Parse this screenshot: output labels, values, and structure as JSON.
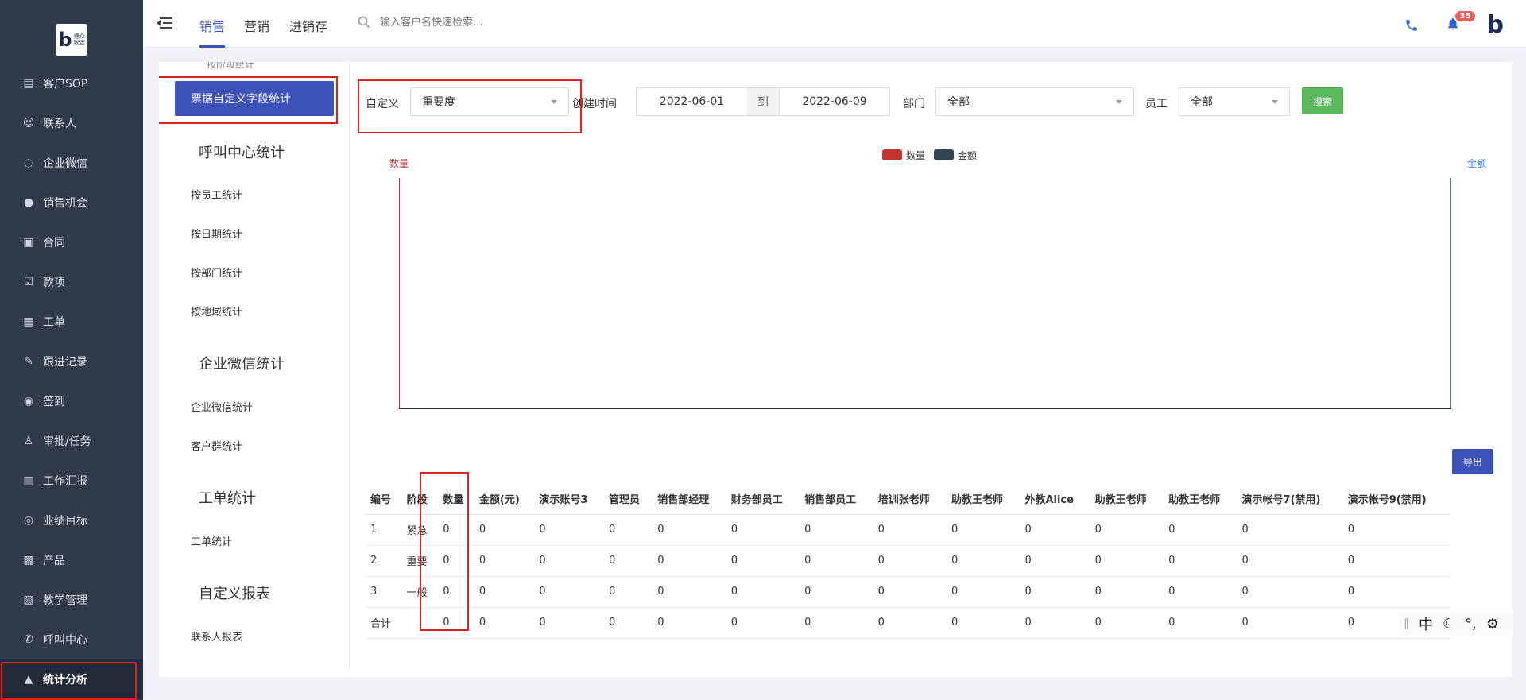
{
  "logo": {
    "letter": "b",
    "line1": "博众",
    "line2": "致远"
  },
  "nav": {
    "items": [
      {
        "label": "客户SOP",
        "icon": "sop-icon"
      },
      {
        "label": "联系人",
        "icon": "person-icon"
      },
      {
        "label": "企业微信",
        "icon": "chat-icon"
      },
      {
        "label": "销售机会",
        "icon": "moneybag-icon"
      },
      {
        "label": "合同",
        "icon": "contract-icon"
      },
      {
        "label": "款项",
        "icon": "payment-icon"
      },
      {
        "label": "工单",
        "icon": "ticket-icon"
      },
      {
        "label": "跟进记录",
        "icon": "edit-icon"
      },
      {
        "label": "签到",
        "icon": "location-icon"
      },
      {
        "label": "审批/任务",
        "icon": "approval-icon"
      },
      {
        "label": "工作汇报",
        "icon": "report-icon"
      },
      {
        "label": "业绩目标",
        "icon": "target-icon"
      },
      {
        "label": "产品",
        "icon": "grid-icon"
      },
      {
        "label": "教学管理",
        "icon": "teaching-icon"
      },
      {
        "label": "呼叫中心",
        "icon": "phone-icon"
      },
      {
        "label": "统计分析",
        "icon": "chart-icon",
        "active": true
      }
    ]
  },
  "topbar": {
    "tabs": [
      "销售",
      "营销",
      "进销存"
    ],
    "active_tab": 0,
    "search_placeholder": "输入客户名快速检索...",
    "notification_count": "35"
  },
  "subnav": {
    "cut_text": "按阶段统计",
    "active": "票据自定义字段统计",
    "groups": [
      {
        "title": "呼叫中心统计",
        "links": [
          "按员工统计",
          "按日期统计",
          "按部门统计",
          "按地域统计"
        ]
      },
      {
        "title": "企业微信统计",
        "links": [
          "企业微信统计",
          "客户群统计"
        ]
      },
      {
        "title": "工单统计",
        "links": [
          "工单统计"
        ]
      },
      {
        "title": "自定义报表",
        "links": [
          "联系人报表"
        ]
      }
    ]
  },
  "filters": {
    "custom_label": "自定义",
    "custom_value": "重要度",
    "created_label": "创建时间",
    "date_from": "2022-06-01",
    "to_label": "到",
    "date_to": "2022-06-09",
    "dept_label": "部门",
    "dept_value": "全部",
    "staff_label": "员工",
    "staff_value": "全部",
    "search_button": "搜索"
  },
  "export_button": "导出",
  "chart_data": {
    "type": "bar",
    "categories": [],
    "series": [
      {
        "name": "数量",
        "values": [],
        "color": "#c23531"
      },
      {
        "name": "金额",
        "values": [],
        "color": "#2f4554"
      }
    ],
    "ylabel_left": "数量",
    "ylabel_right": "金额",
    "legend": "top-center"
  },
  "table": {
    "headers": [
      "编号",
      "阶段",
      "数量",
      "金额(元)",
      "演示账号3",
      "管理员",
      "销售部经理",
      "财务部员工",
      "销售部员工",
      "培训张老师",
      "助教王老师",
      "外教Alice",
      "助教王老师",
      "助教王老师",
      "演示帐号7(禁用)",
      "演示帐号9(禁用)"
    ],
    "rows": [
      [
        "1",
        "紧急",
        "0",
        "0",
        "0",
        "0",
        "0",
        "0",
        "0",
        "0",
        "0",
        "0",
        "0",
        "0",
        "0",
        "0"
      ],
      [
        "2",
        "重要",
        "0",
        "0",
        "0",
        "0",
        "0",
        "0",
        "0",
        "0",
        "0",
        "0",
        "0",
        "0",
        "0",
        "0"
      ],
      [
        "3",
        "一般",
        "0",
        "0",
        "0",
        "0",
        "0",
        "0",
        "0",
        "0",
        "0",
        "0",
        "0",
        "0",
        "0",
        "0"
      ],
      [
        "合计",
        "",
        "0",
        "0",
        "0",
        "0",
        "0",
        "0",
        "0",
        "0",
        "0",
        "0",
        "0",
        "0",
        "0",
        "0"
      ]
    ]
  },
  "ime": {
    "lang": "中",
    "punct": "°,"
  }
}
